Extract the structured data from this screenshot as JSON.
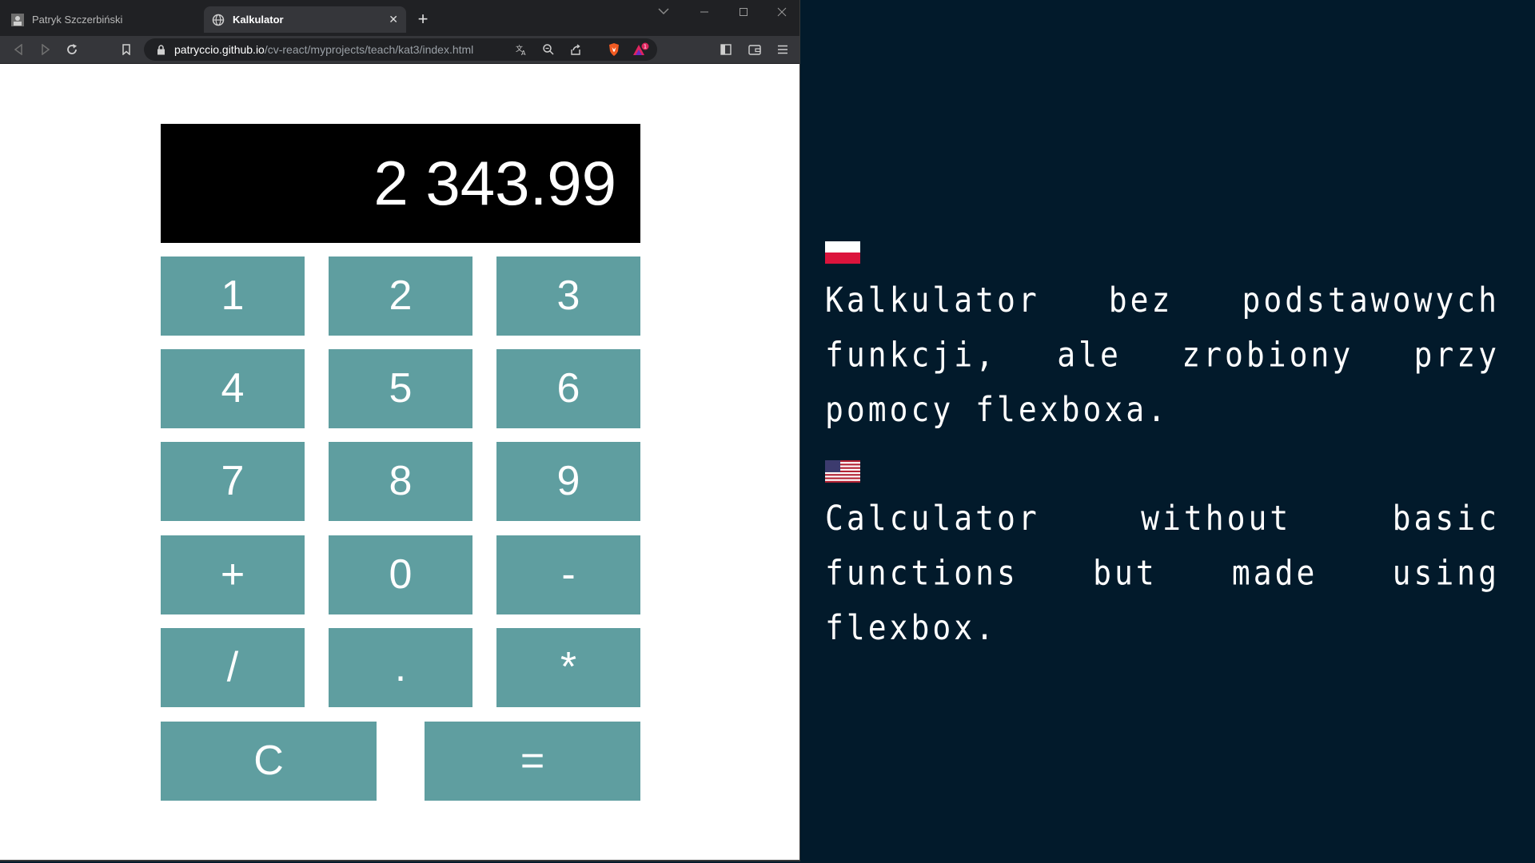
{
  "browser": {
    "tabs": [
      {
        "title": "Patryk Szczerbiński",
        "active": false
      },
      {
        "title": "Kalkulator",
        "active": true
      }
    ],
    "url_host": "patryccio.github.io",
    "url_path": "/cv-react/myprojects/teach/kat3/index.html",
    "rewards_badge": "1"
  },
  "calculator": {
    "display": "2 343.99",
    "keys": {
      "k1": "1",
      "k2": "2",
      "k3": "3",
      "k4": "4",
      "k5": "5",
      "k6": "6",
      "k7": "7",
      "k8": "8",
      "k9": "9",
      "plus": "+",
      "zero": "0",
      "minus": "-",
      "divide": "/",
      "dot": ".",
      "multiply": "*",
      "clear": "C",
      "equals": "="
    },
    "key_color": "#5f9ea0",
    "display_color": "#000000"
  },
  "description": {
    "pl": "Kalkulator bez podstawowych funkcji, ale zrobiony przy pomocy flexboxa.",
    "en": "Calculator without basic functions but made using flexbox.",
    "background": "#021a2b"
  }
}
